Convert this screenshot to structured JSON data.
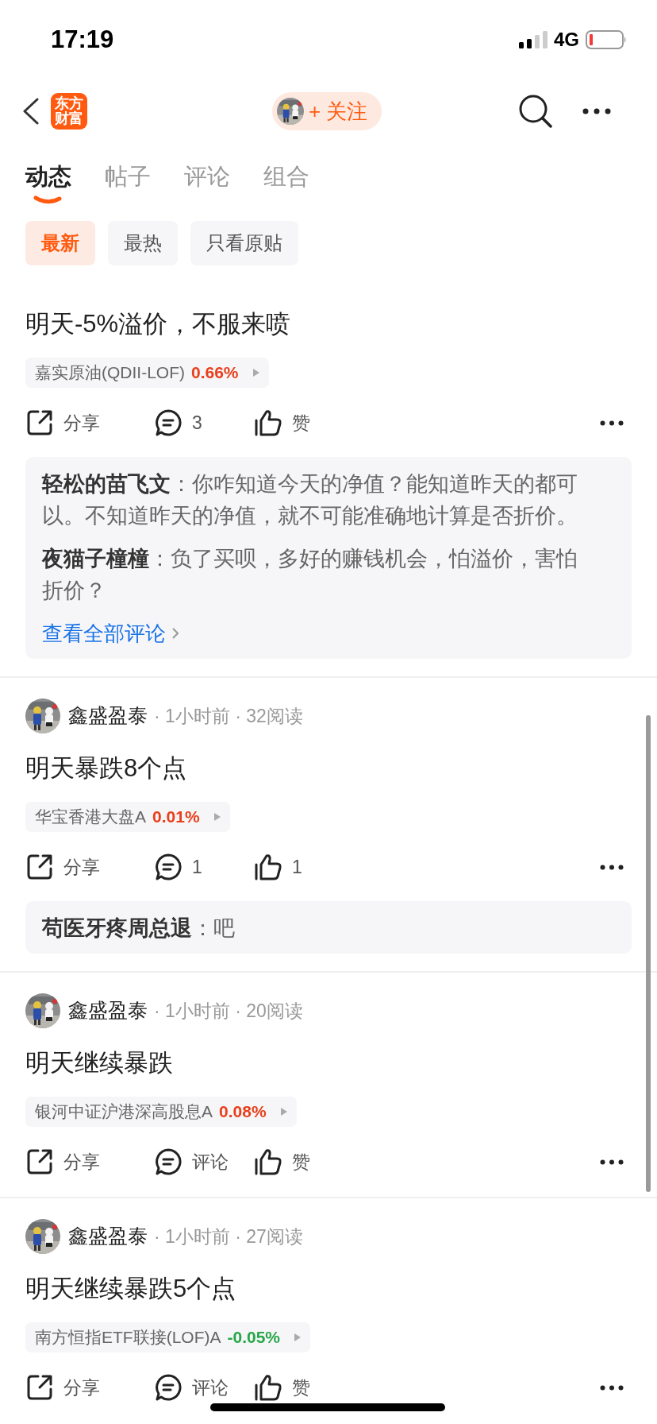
{
  "status_bar": {
    "time": "17:19",
    "network": "4G"
  },
  "header": {
    "logo": "东方财富",
    "follow_button": "+ 关注"
  },
  "tabs": [
    {
      "label": "动态",
      "selected": true
    },
    {
      "label": "帖子",
      "selected": false
    },
    {
      "label": "评论",
      "selected": false
    },
    {
      "label": "组合",
      "selected": false
    }
  ],
  "filters": [
    {
      "label": "最新",
      "selected": true
    },
    {
      "label": "最热",
      "selected": false
    },
    {
      "label": "只看原贴",
      "selected": false
    }
  ],
  "posts": [
    {
      "title": "明天-5%溢价，不服来喷",
      "fund": {
        "name": "嘉实原油(QDII-LOF)",
        "change": "0.66%",
        "color": "#e8401c"
      },
      "actions": {
        "share": "分享",
        "comment": "3",
        "like": "赞"
      },
      "comments": [
        "**轻松的苗飞文**：你咋知道今天的净值？能知道昨天的都可以。不知道昨天的净值，就不可能准确地计算是否折价。",
        "**夜猫子橦橦**：负了买呗，多好的赚钱机会，怕溢价，害怕折价？"
      ],
      "view_all": "查看全部评论"
    },
    {
      "author": "鑫盛盈泰",
      "meta": "· 1小时前 · 32阅读",
      "title": "明天暴跌8个点",
      "fund": {
        "name": "华宝香港大盘A",
        "change": "0.01%",
        "color": "#e8401c"
      },
      "actions": {
        "share": "分享",
        "comment": "1",
        "like": "1"
      },
      "comments": [
        "**苟医牙疼周总退**：吧"
      ]
    },
    {
      "author": "鑫盛盈泰",
      "meta": "· 1小时前 · 20阅读",
      "title": "明天继续暴跌",
      "fund": {
        "name": "银河中证沪港深高股息A",
        "change": "0.08%",
        "color": "#e8401c"
      },
      "actions": {
        "share": "分享",
        "comment": "评论",
        "like": "赞"
      }
    },
    {
      "author": "鑫盛盈泰",
      "meta": "· 1小时前 · 27阅读",
      "title": "明天继续暴跌5个点",
      "fund": {
        "name": "南方恒指ETF联接(LOF)A",
        "change": "-0.05%",
        "color": "#27a74a"
      },
      "actions": {
        "share": "分享",
        "comment": "评论",
        "like": "赞"
      }
    }
  ]
}
